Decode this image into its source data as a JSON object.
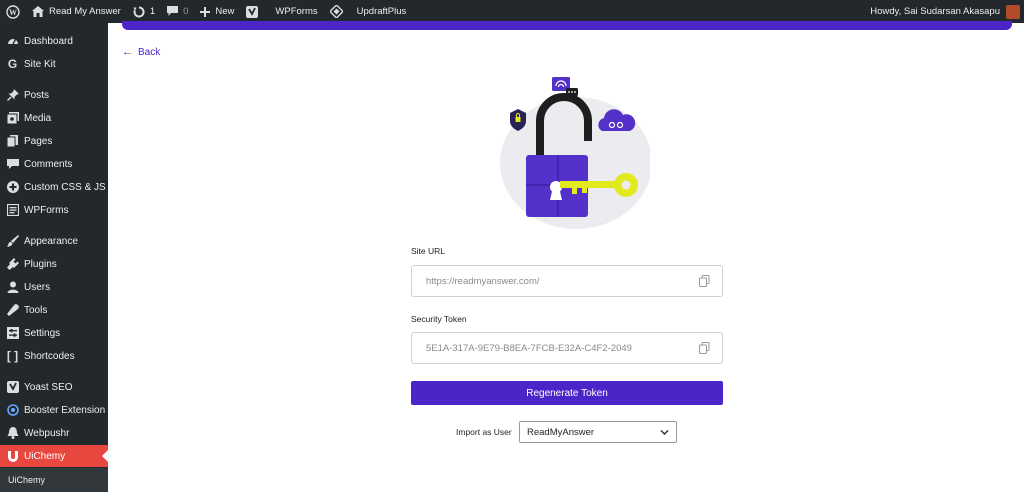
{
  "adminbar": {
    "site_name": "Read My Answer",
    "updates_count": "1",
    "comments_count": "0",
    "new_label": "New",
    "wpforms_label": "WPForms",
    "updraft_label": "UpdraftPlus",
    "greeting": "Howdy, Sai Sudarsan Akasapu"
  },
  "sidebar": {
    "items": [
      {
        "label": "Dashboard",
        "icon": "dashboard-icon"
      },
      {
        "label": "Site Kit",
        "icon": "google-g-icon"
      },
      {
        "label": "Posts",
        "icon": "pin-icon"
      },
      {
        "label": "Media",
        "icon": "media-icon"
      },
      {
        "label": "Pages",
        "icon": "pages-icon"
      },
      {
        "label": "Comments",
        "icon": "comment-icon"
      },
      {
        "label": "Custom CSS & JS",
        "icon": "plus-circle-icon"
      },
      {
        "label": "WPForms",
        "icon": "forms-icon"
      },
      {
        "label": "Appearance",
        "icon": "brush-icon"
      },
      {
        "label": "Plugins",
        "icon": "plug-icon"
      },
      {
        "label": "Users",
        "icon": "user-icon"
      },
      {
        "label": "Tools",
        "icon": "wrench-icon"
      },
      {
        "label": "Settings",
        "icon": "settings-icon"
      },
      {
        "label": "Shortcodes",
        "icon": "brackets-icon"
      },
      {
        "label": "Yoast SEO",
        "icon": "yoast-icon"
      },
      {
        "label": "Booster Extension",
        "icon": "booster-icon"
      },
      {
        "label": "Webpushr",
        "icon": "bell-icon"
      },
      {
        "label": "UiChemy",
        "icon": "uichemy-icon",
        "active": true
      }
    ],
    "submenu_label": "UiChemy"
  },
  "main": {
    "back_label": "Back",
    "site_url_label": "Site URL",
    "site_url_value": "https://readmyanswer.com/",
    "token_label": "Security Token",
    "token_value": "5E1A-317A-9E79-B8EA-7FCB-E32A-C4F2-2049",
    "regenerate_label": "Regenerate Token",
    "import_label": "Import as User",
    "import_value": "ReadMyAnswer"
  },
  "colors": {
    "accent": "#4c25c9",
    "sidebar_bg": "#23282d",
    "active_menu": "#e8473f",
    "key_yellow": "#e2ea1f"
  }
}
